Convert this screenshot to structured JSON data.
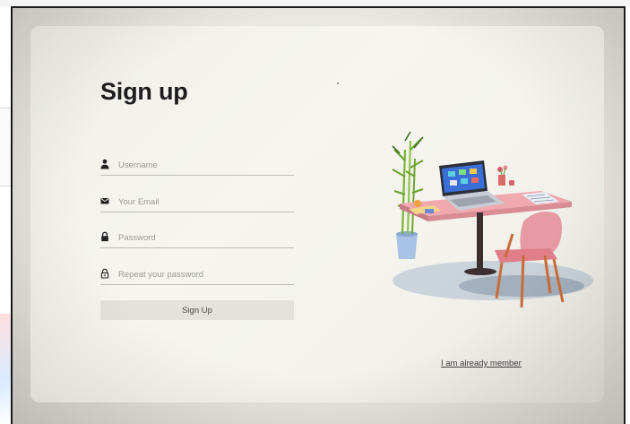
{
  "signup": {
    "title": "Sign up",
    "fields": [
      {
        "placeholder": "Username",
        "icon": "user-icon"
      },
      {
        "placeholder": "Your Email",
        "icon": "email-icon"
      },
      {
        "placeholder": "Password",
        "icon": "lock-icon"
      },
      {
        "placeholder": "Repeat your password",
        "icon": "lock-outline-icon"
      }
    ],
    "submit_label": "Sign Up",
    "member_link": "I am already member"
  },
  "colors": {
    "card": "#f3f2ec",
    "text": "#1d1d1f",
    "button": "#e3e2dc",
    "chair": "#e79aa3",
    "desk": "#f0a9ae",
    "plant": "#8cbf3f"
  },
  "illustration": "workspace-illustration"
}
